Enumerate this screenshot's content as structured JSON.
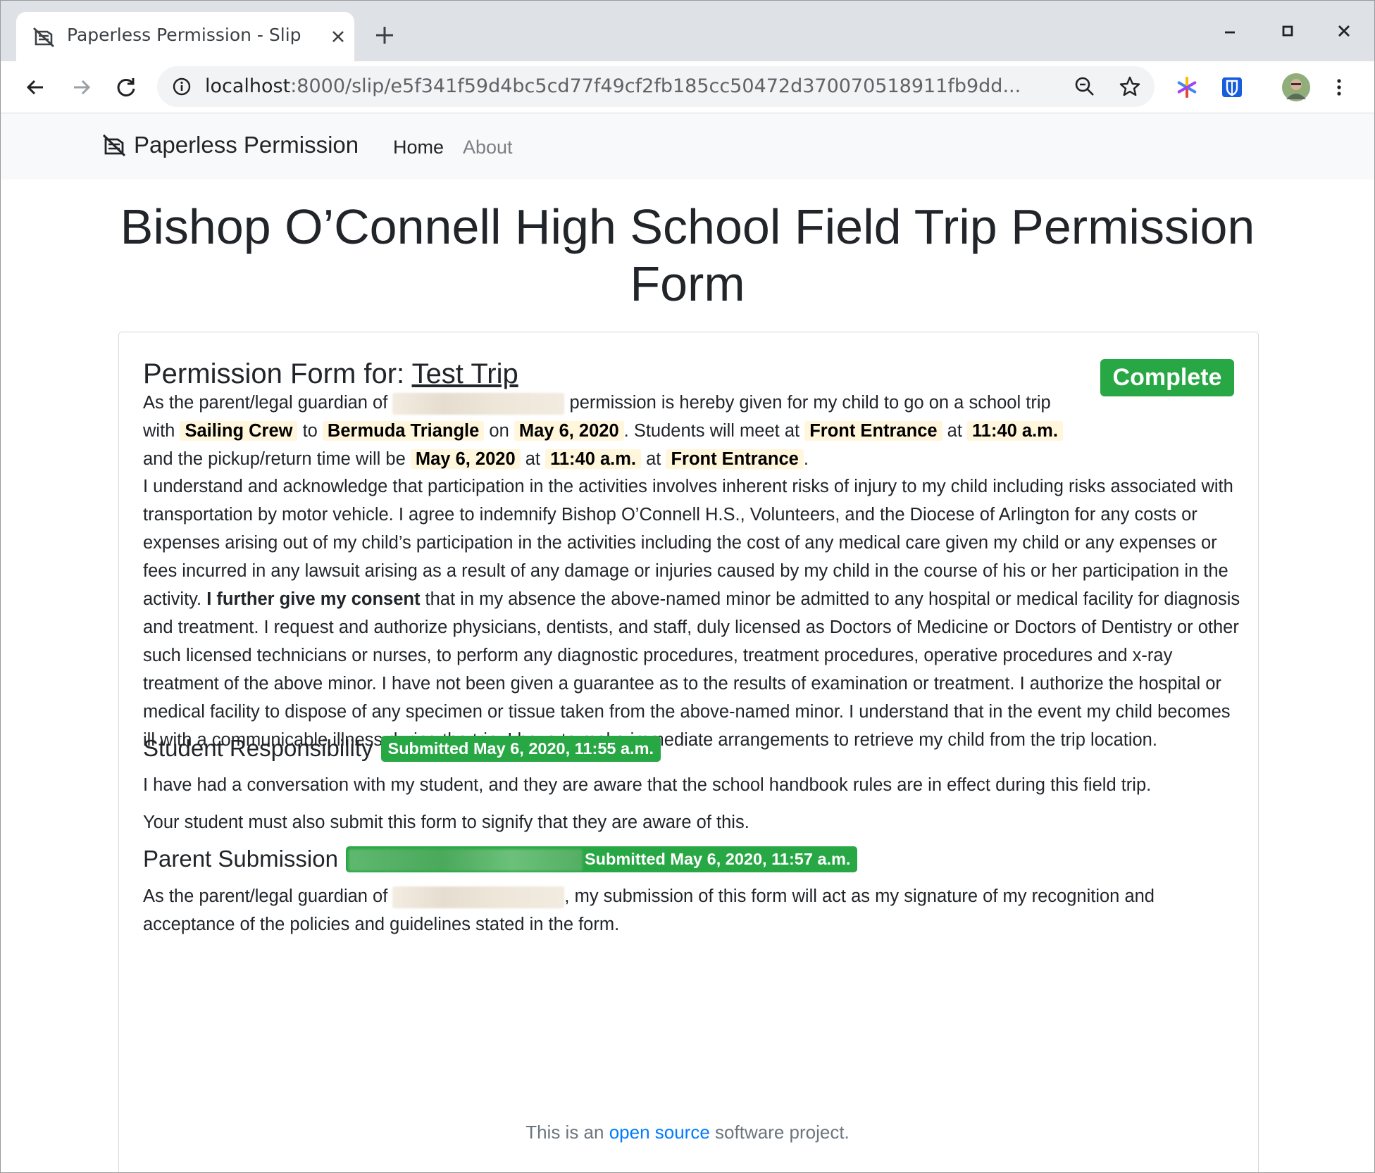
{
  "browser": {
    "tab_title": "Paperless Permission - Slip",
    "url_host": "localhost",
    "url_rest": ":8000/slip/e5f341f59d4bc5cd77f49cf2fb185cc50472d370070518911fb9dd..."
  },
  "navbar": {
    "brand": "Paperless Permission",
    "home": "Home",
    "about": "About"
  },
  "page": {
    "title": "Bishop O’Connell High School Field Trip Permission Form"
  },
  "form": {
    "heading_prefix": "Permission Form for: ",
    "trip_name": "Test Trip",
    "status": "Complete",
    "intro": {
      "t1": "As the parent/legal guardian of ",
      "t2": " permission is hereby given for my child to go on a school trip with ",
      "group": "Sailing Crew",
      "t3": " to ",
      "destination": "Bermuda Triangle",
      "t4": " on ",
      "depart_date": "May 6, 2020",
      "t5": ". Students will meet at ",
      "meet_place": "Front Entrance",
      "t6": " at ",
      "meet_time": "11:40 a.m.",
      "t7": " and the pickup/return time will be ",
      "return_date": "May 6, 2020",
      "t8": " at ",
      "return_time": "11:40 a.m.",
      "t9": " at ",
      "return_place": "Front Entrance",
      "t10": "."
    },
    "waiver": {
      "p1": "I understand and acknowledge that participation in the activities involves inherent risks of injury to my child including risks associated with transportation by motor vehicle. I agree to indemnify Bishop O’Connell H.S., Volunteers, and the Diocese of Arlington for any costs or expenses arising out of my child’s participation in the activities including the cost of any medical care given my child or any expenses or fees incurred in any lawsuit arising as a result of any damage or injuries caused by my child in the course of his or her participation in the activity. ",
      "bold": "I further give my consent",
      "p2": " that in my absence the above-named minor be admitted to any hospital or medical facility for diagnosis and treatment. I request and authorize physicians, dentists, and staff, duly licensed as Doctors of Medicine or Doctors of Dentistry or other such licensed technicians or nurses, to perform any diagnostic procedures, treatment procedures, operative procedures and x-ray treatment of the above minor. I have not been given a guarantee as to the results of examination or treatment. I authorize the hospital or medical facility to dispose of any specimen or tissue taken from the above-named minor. I understand that in the event my child becomes ill with a communicable illness during the trip, I have to make immediate arrangements to retrieve my child from the trip location."
    },
    "student": {
      "heading": "Student Responsibility",
      "badge": "Submitted May 6, 2020, 11:55 a.m.",
      "p1": "I have had a conversation with my student, and they are aware that the school handbook rules are in effect during this field trip.",
      "p2": "Your student must also submit this form to signify that they are aware of this."
    },
    "parent": {
      "heading": "Parent Submission",
      "badge": "Submitted May 6, 2020, 11:57 a.m.",
      "t1": "As the parent/legal guardian of ",
      "t2": ", my submission of this form will act as my signature of my recognition and acceptance of the policies and guidelines stated in the form."
    }
  },
  "footer": {
    "pre": "This is an ",
    "link": "open source",
    "post": " software project."
  }
}
